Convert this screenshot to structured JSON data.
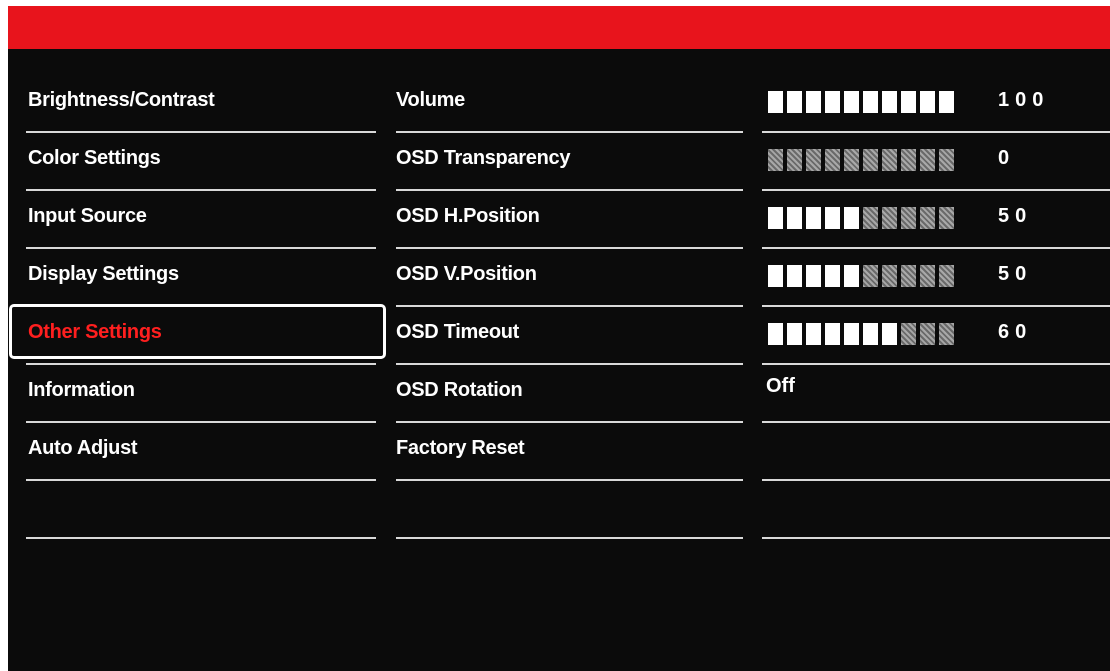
{
  "colors": {
    "header": "#e8141c",
    "background": "#0b0b0b",
    "text": "#ffffff",
    "selected_text": "#ff1f1f",
    "divider": "#d9d9d9"
  },
  "main_menu": {
    "items": [
      {
        "label": "Brightness/Contrast",
        "selected": false
      },
      {
        "label": "Color Settings",
        "selected": false
      },
      {
        "label": "Input Source",
        "selected": false
      },
      {
        "label": "Display Settings",
        "selected": false
      },
      {
        "label": "Other Settings",
        "selected": true
      },
      {
        "label": "Information",
        "selected": false
      },
      {
        "label": "Auto Adjust",
        "selected": false
      },
      {
        "label": "",
        "selected": false
      }
    ]
  },
  "submenu": {
    "items": [
      {
        "label": "Volume"
      },
      {
        "label": "OSD Transparency"
      },
      {
        "label": "OSD H.Position"
      },
      {
        "label": "OSD V.Position"
      },
      {
        "label": "OSD Timeout"
      },
      {
        "label": "OSD Rotation"
      },
      {
        "label": "Factory Reset"
      },
      {
        "label": ""
      }
    ]
  },
  "values": {
    "items": [
      {
        "type": "meter",
        "level": 1.0,
        "value": "100"
      },
      {
        "type": "meter",
        "level": 0.0,
        "value": "0"
      },
      {
        "type": "meter",
        "level": 0.5,
        "value": "50"
      },
      {
        "type": "meter",
        "level": 0.5,
        "value": "50"
      },
      {
        "type": "meter",
        "level": 0.7,
        "value": "60"
      },
      {
        "type": "text",
        "value": "Off"
      },
      {
        "type": "empty",
        "value": ""
      },
      {
        "type": "empty",
        "value": ""
      }
    ]
  }
}
